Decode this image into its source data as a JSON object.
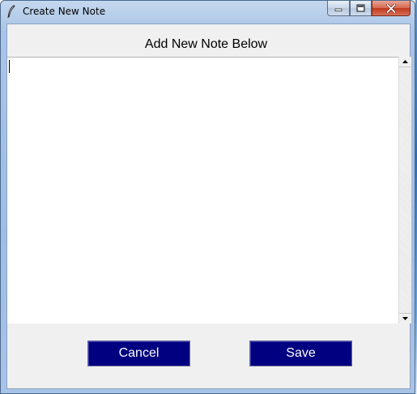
{
  "window": {
    "title": "Create New Note",
    "icons": {
      "app": "feather-quill-icon",
      "minimize": "minimize-icon",
      "maximize": "maximize-icon",
      "close": "close-icon"
    }
  },
  "form": {
    "heading": "Add New Note Below",
    "note_text": "",
    "buttons": {
      "cancel": "Cancel",
      "save": "Save"
    }
  },
  "colors": {
    "button_bg": "#000080",
    "button_text": "#ffffff",
    "client_bg": "#f0f0f0",
    "close_button": "#c2391c"
  }
}
